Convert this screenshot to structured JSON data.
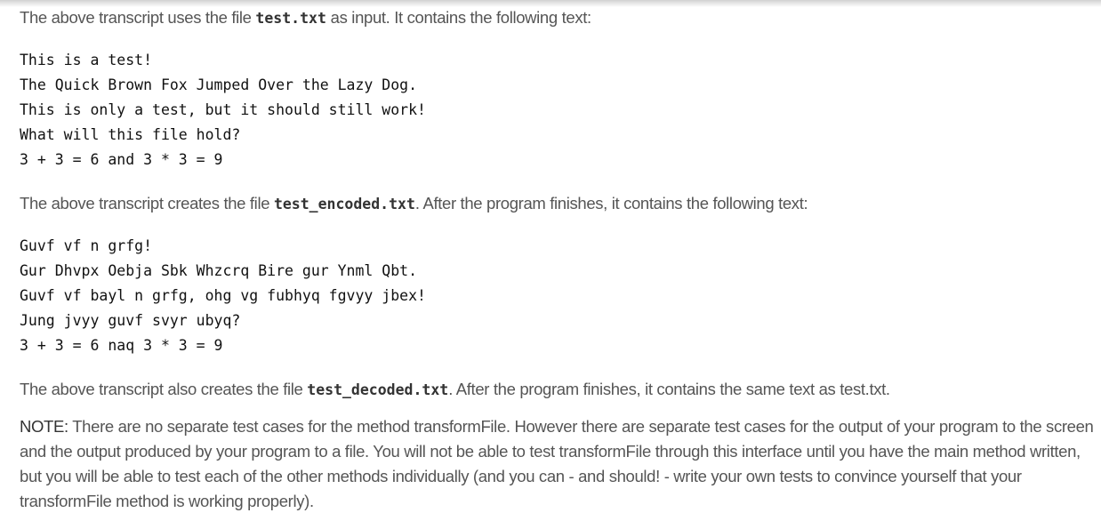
{
  "paragraph1": {
    "before": "The above transcript uses the file ",
    "filename": "test.txt",
    "after": " as input. It contains the following text:"
  },
  "input_file": {
    "lines": [
      "This is a test!",
      "The Quick Brown Fox Jumped Over the Lazy Dog.",
      "This is only a test, but it should still work!",
      "What will this file hold?",
      "3 + 3 = 6 and 3 * 3 = 9"
    ]
  },
  "paragraph2": {
    "before": "The above transcript creates the file ",
    "filename": "test_encoded.txt",
    "after": ". After the program finishes, it contains the following text:"
  },
  "encoded_file": {
    "lines": [
      "Guvf vf n grfg!",
      "Gur Dhvpx Oebja Sbk Whzcrq Bire gur Ynml Qbt.",
      "Guvf vf bayl n grfg, ohg vg fubhyq fgvyy jbex!",
      "Jung jvyy guvf svyr ubyq?",
      "3 + 3 = 6 naq 3 * 3 = 9"
    ]
  },
  "paragraph3": {
    "before": "The above transcript also creates the file ",
    "filename": "test_decoded.txt",
    "after": ". After the program finishes, it contains the same text as test.txt."
  },
  "note": {
    "label": "NOTE:",
    "text": " There are no separate test cases for the method transformFile. However there are separate test cases for the output of your program to the screen and the output produced by your program to a file. You will not be able to test transformFile through this interface until you have the main method written, but you will be able to test each of the other methods individually (and you can - and should! - write your own tests to convince yourself that your transformFile method is working properly)."
  }
}
